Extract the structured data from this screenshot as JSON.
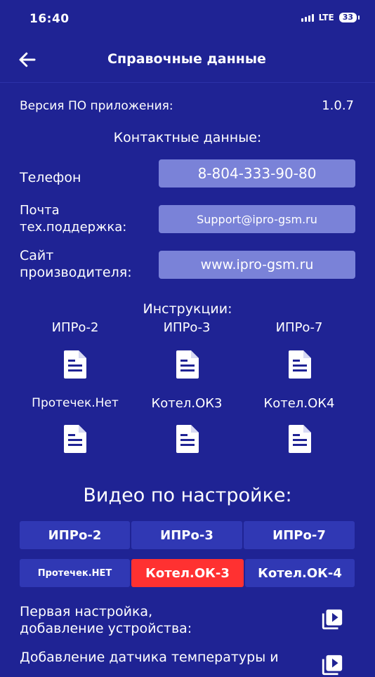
{
  "status_bar": {
    "time": "16:40",
    "network": "LTE",
    "battery": "33"
  },
  "header": {
    "title": "Справочные данные",
    "back_icon": "arrow-left-icon"
  },
  "app_version": {
    "label": "Версия ПО приложения:",
    "value": "1.0.7"
  },
  "contacts": {
    "heading": "Контактные данные:",
    "phone_label": "Телефон",
    "phone_value": "8-804-333-90-80",
    "email_label_1": "Почта",
    "email_label_2": "тех.поддержка:",
    "email_value": "Support@ipro-gsm.ru",
    "site_label_1": "Сайт",
    "site_label_2": "производителя:",
    "site_value": "www.ipro-gsm.ru"
  },
  "instructions": {
    "heading": "Инструкции:",
    "items": [
      {
        "label": "ИПРо-2"
      },
      {
        "label": "ИПРо-3"
      },
      {
        "label": "ИПРо-7"
      },
      {
        "label": "Протечек.Нет"
      },
      {
        "label": "Котел.ОК3"
      },
      {
        "label": "Котел.ОК4"
      }
    ],
    "icon": "document-icon"
  },
  "video": {
    "heading": "Видео по настройке:",
    "tabs_row1": [
      "ИПРо-2",
      "ИПРо-3",
      "ИПРо-7"
    ],
    "tabs_row2": [
      "Протечек.НЕТ",
      "Котел.ОК-3",
      "Котел.ОК-4"
    ],
    "active_tab": "Котел.ОК-3",
    "items": [
      {
        "line1": "Первая настройка,",
        "line2": "добавление устройства:"
      },
      {
        "line1": "Добавление датчика температуры и"
      }
    ],
    "play_icon": "video-library-icon"
  },
  "colors": {
    "background": "#1f2394",
    "button": "#7a82d8",
    "segment": "#3038b4",
    "active": "#ff3131"
  }
}
